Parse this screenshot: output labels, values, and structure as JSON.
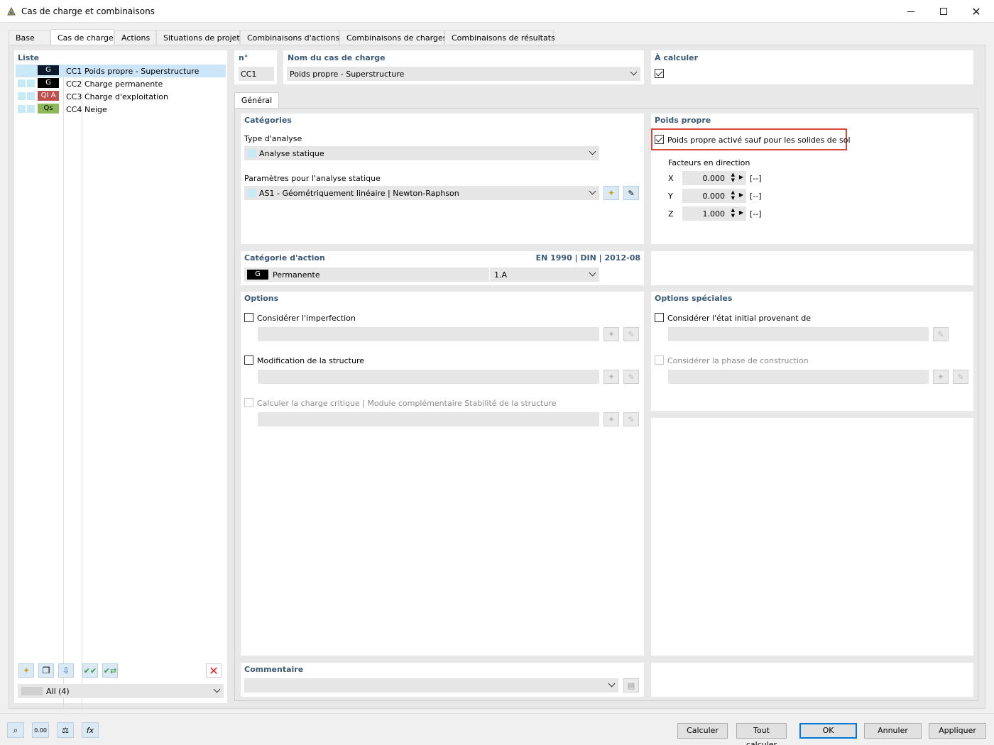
{
  "window": {
    "title": "Cas de charge et combinaisons"
  },
  "tabs": [
    "Base",
    "Cas de charge",
    "Actions",
    "Situations de projet",
    "Combinaisons d'actions",
    "Combinaisons de charges",
    "Combinaisons de résultats"
  ],
  "list": {
    "heading": "Liste",
    "items": [
      {
        "badge": "G",
        "badge_bg": "#0a1a2c",
        "badge_fg": "#ffffff",
        "id": "CC1",
        "name": "Poids propre - Superstructure"
      },
      {
        "badge": "G",
        "badge_bg": "#000000",
        "badge_fg": "#ffffff",
        "id": "CC2",
        "name": "Charge permanente"
      },
      {
        "badge": "QI A",
        "badge_bg": "#c0504d",
        "badge_fg": "#ffffff",
        "id": "CC3",
        "name": "Charge d'exploitation"
      },
      {
        "badge": "Qs",
        "badge_bg": "#8db85a",
        "badge_fg": "#000000",
        "id": "CC4",
        "name": "Neige"
      }
    ],
    "filter": "All (4)"
  },
  "header": {
    "no_label": "n°",
    "no_value": "CC1",
    "name_label": "Nom du cas de charge",
    "name_value": "Poids propre - Superstructure",
    "calc_label": "À calculer"
  },
  "subtab": "Général",
  "categories": {
    "heading": "Catégories",
    "analysis_label": "Type d'analyse",
    "analysis_value": "Analyse statique",
    "params_label": "Paramètres pour l'analyse statique",
    "params_value": "AS1 - Géométriquement linéaire | Newton-Raphson"
  },
  "self_weight": {
    "heading": "Poids propre",
    "checkbox": "Poids propre activé sauf pour les solides de sol",
    "factors_label": "Facteurs en direction",
    "factors": [
      {
        "axis": "X",
        "value": "0.000",
        "unit": "[--]"
      },
      {
        "axis": "Y",
        "value": "0.000",
        "unit": "[--]"
      },
      {
        "axis": "Z",
        "value": "1.000",
        "unit": "[--]"
      }
    ]
  },
  "action_category": {
    "heading": "Catégorie d'action",
    "norm": "EN 1990 | DIN | 2012-08",
    "badge": "G",
    "value": "Permanente",
    "code": "1.A"
  },
  "options": {
    "heading": "Options",
    "imperfection": "Considérer l'imperfection",
    "modification": "Modification de la structure",
    "critical": "Calculer la charge critique | Module complémentaire Stabilité de la structure"
  },
  "special_options": {
    "heading": "Options spéciales",
    "initial_state": "Considérer l'état initial provenant de",
    "construction": "Considérer la phase de construction"
  },
  "comment": {
    "heading": "Commentaire"
  },
  "footer": {
    "calc": "Calculer",
    "calc_all": "Tout calculer",
    "ok": "OK",
    "cancel": "Annuler",
    "apply": "Appliquer",
    "num_icon_text": "0.00"
  },
  "colors": {
    "accent": "#0078d7",
    "highlight_box": "#d9473c",
    "label_blue": "#3b5a76"
  }
}
